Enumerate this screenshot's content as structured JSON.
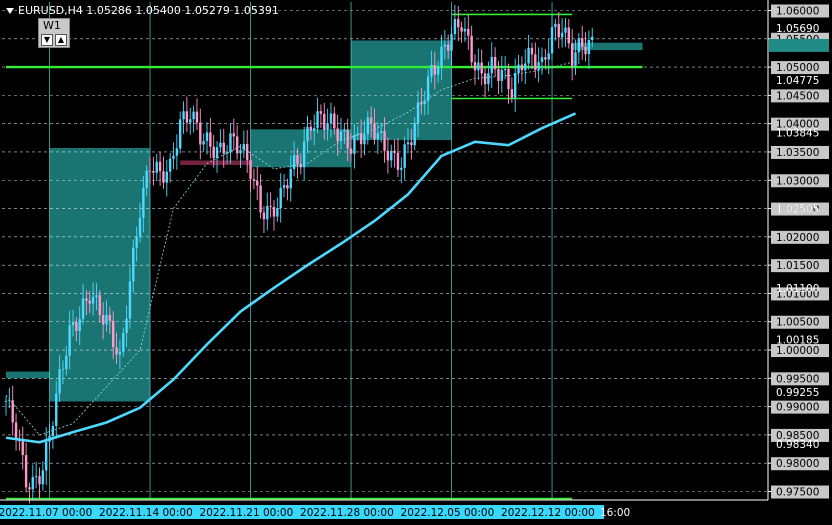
{
  "header": {
    "symbol": "EURUSD,H4",
    "open": "1.05286",
    "high": "1.05400",
    "low": "1.05279",
    "close": "1.05391"
  },
  "toolbar": {
    "w1_label": "W1",
    "arrow_down": "▼",
    "arrow_up": "▲"
  },
  "chart_data": {
    "type": "candlestick",
    "symbol": "EURUSD",
    "timeframe": "H4",
    "ylim": [
      0.9735,
      1.0615
    ],
    "y_ticks": [
      "1.06000",
      "1.05500",
      "1.05000",
      "1.04500",
      "1.04000",
      "1.03500",
      "1.03000",
      "1.02500",
      "1.02000",
      "1.01500",
      "1.01000",
      "1.00500",
      "1.00000",
      "0.99500",
      "0.99000",
      "0.98500",
      "0.98000",
      "0.97500"
    ],
    "price_tags": [
      "1.05690",
      "1.05391",
      "1.04775",
      "1.03845",
      "1.02505",
      "1.01100",
      "1.00185",
      "0.99255",
      "0.98340"
    ],
    "x_labels": [
      {
        "text": "2022.11.07 00:00",
        "bar": 13
      },
      {
        "text": "2022.11.14 00:00",
        "bar": 43
      },
      {
        "text": "2022.11.21 00:00",
        "bar": 73
      },
      {
        "text": "2022.11.28 00:00",
        "bar": 103
      },
      {
        "text": "2022.12.05 00:00",
        "bar": 133
      },
      {
        "text": "2022.12.12 00:00",
        "bar": 163
      },
      {
        "text": "16:00",
        "bar": 177
      }
    ],
    "bars_total": 182,
    "horizontal_levels": [
      {
        "price": 1.0593,
        "color": "#33ee33",
        "from_bar": 133,
        "to_bar": 169
      },
      {
        "price": 1.05,
        "color": "#33ee33",
        "from_bar": 0,
        "to_bar": 190,
        "thick": true
      },
      {
        "price": 1.04445,
        "color": "#33ee33",
        "from_bar": 133,
        "to_bar": 169
      },
      {
        "price": 0.97375,
        "color": "#33ee33",
        "from_bar": 0,
        "to_bar": 169
      }
    ],
    "zones": [
      {
        "from_bar": 13,
        "to_bar": 43,
        "high": 1.0357,
        "low": 0.9909,
        "color": "#1f8a86"
      },
      {
        "from_bar": 0,
        "to_bar": 13,
        "high": 0.9962,
        "low": 0.995,
        "color": "#1f8a86"
      },
      {
        "from_bar": 73,
        "to_bar": 103,
        "high": 1.039,
        "low": 1.0323,
        "color": "#1f8a86"
      },
      {
        "from_bar": 103,
        "to_bar": 133,
        "high": 1.0547,
        "low": 1.0371,
        "color": "#1f8a86"
      },
      {
        "from_bar": 169,
        "to_bar": 190,
        "high": 1.0543,
        "low": 1.053,
        "color": "#1f8a86"
      },
      {
        "from_bar": 52,
        "to_bar": 73,
        "high": 1.0335,
        "low": 1.0327,
        "color": "#8a2a4a"
      }
    ],
    "moving_average": [
      [
        0,
        0.9845
      ],
      [
        10,
        0.9837
      ],
      [
        20,
        0.9855
      ],
      [
        30,
        0.9872
      ],
      [
        40,
        0.9898
      ],
      [
        50,
        0.9948
      ],
      [
        60,
        1.001
      ],
      [
        70,
        1.0068
      ],
      [
        80,
        1.011
      ],
      [
        90,
        1.015
      ],
      [
        100,
        1.0188
      ],
      [
        110,
        1.0228
      ],
      [
        120,
        1.0275
      ],
      [
        130,
        1.0343
      ],
      [
        140,
        1.0368
      ],
      [
        150,
        1.0362
      ],
      [
        160,
        1.0392
      ],
      [
        170,
        1.0418
      ]
    ],
    "trend_line_dashed": [
      [
        0,
        0.992
      ],
      [
        10,
        0.985
      ],
      [
        20,
        0.987
      ],
      [
        40,
        1.0
      ],
      [
        50,
        1.025
      ],
      [
        60,
        1.033
      ],
      [
        70,
        1.036
      ],
      [
        80,
        1.032
      ],
      [
        90,
        1.033
      ],
      [
        100,
        1.037
      ],
      [
        110,
        1.039
      ],
      [
        120,
        1.042
      ],
      [
        130,
        1.046
      ],
      [
        140,
        1.048
      ],
      [
        150,
        1.0485
      ],
      [
        160,
        1.0495
      ],
      [
        170,
        1.051
      ]
    ],
    "colors": {
      "bull": "#4dd9ff",
      "bear": "#ff99cc",
      "grid": "#ffffff",
      "ma": "#4dd9ff",
      "level": "#33ee33",
      "price_tag_bg": "#c8c8c8",
      "date_tag_bg": "#39d8ff"
    },
    "candles": []
  }
}
